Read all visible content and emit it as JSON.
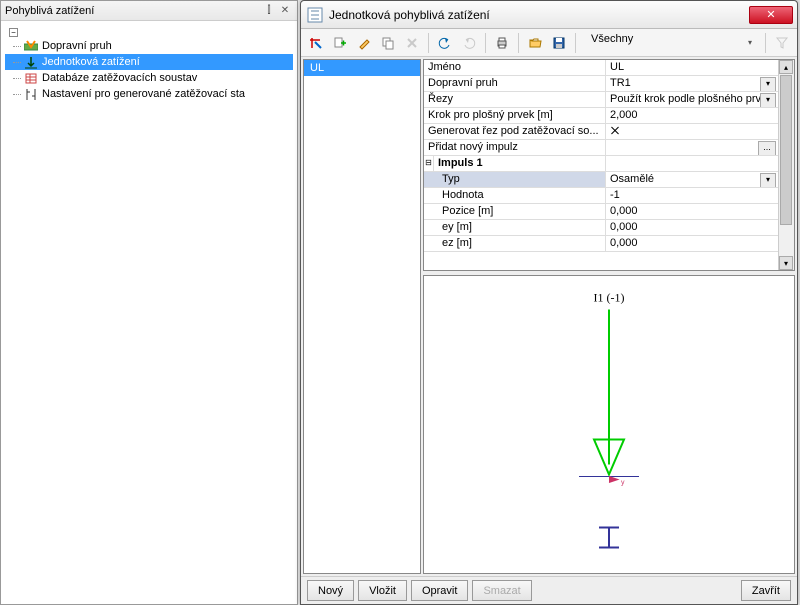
{
  "left_panel": {
    "title": "Pohyblivá zatížení",
    "tree": [
      {
        "label": "Dopravní pruh",
        "selected": false
      },
      {
        "label": "Jednotková zatížení",
        "selected": true
      },
      {
        "label": "Databáze zatěžovacích soustav",
        "selected": false
      },
      {
        "label": "Nastavení pro generované zatěžovací sta",
        "selected": false
      }
    ]
  },
  "dialog": {
    "title": "Jednotková pohyblivá zatížení",
    "toolbar_filter_text": "Všechny",
    "list": {
      "items": [
        "UL"
      ],
      "selected": "UL"
    },
    "props": [
      {
        "label": "Jméno",
        "value": "UL"
      },
      {
        "label": "Dopravní pruh",
        "value": "TR1",
        "dd": true
      },
      {
        "label": "Řezy",
        "value": "Použít krok podle plošného prvk",
        "dd": true
      },
      {
        "label": "Krok pro plošný prvek [m]",
        "value": "2,000"
      },
      {
        "label": "Generovat řez pod zatěžovací so...",
        "value": "",
        "check": true
      },
      {
        "label": "Přidat nový impulz",
        "value": "",
        "dots": true
      },
      {
        "group": true,
        "label": "Impuls 1"
      },
      {
        "indent": true,
        "sel": true,
        "label": "Typ",
        "value": "Osamělé",
        "dd": true
      },
      {
        "indent": true,
        "label": "Hodnota",
        "value": "-1"
      },
      {
        "indent": true,
        "label": "Pozice [m]",
        "value": "0,000"
      },
      {
        "indent": true,
        "label": "ey [m]",
        "value": "0,000"
      },
      {
        "indent": true,
        "label": "ez [m]",
        "value": "0,000"
      }
    ],
    "preview_label": "I1 (-1)",
    "footer": {
      "new": "Nový",
      "insert": "Vložit",
      "edit": "Opravit",
      "delete": "Smazat",
      "close": "Zavřít"
    }
  }
}
